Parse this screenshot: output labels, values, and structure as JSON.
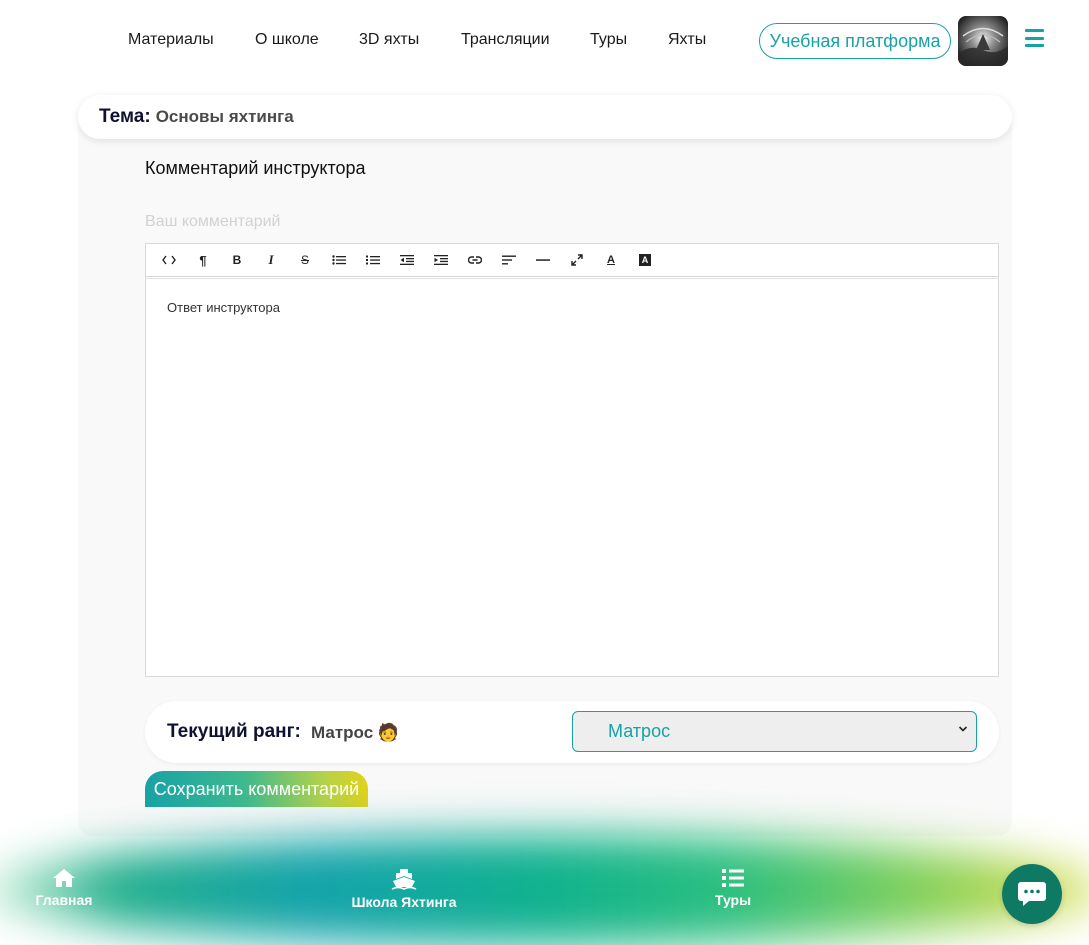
{
  "nav": {
    "links": [
      "Материалы",
      "О школе",
      "3D яхты",
      "Трансляции",
      "Туры",
      "Яхты"
    ],
    "platform_button": "Учебная платформа",
    "accent_color": "#17a2a6"
  },
  "topic": {
    "label": "Тема:",
    "value": "Основы яхтинга"
  },
  "comment_section": {
    "title": "Комментарий инструктора",
    "hint": "Ваш комментарий",
    "toolbar_icons": [
      "code-view",
      "paragraph",
      "bold",
      "italic",
      "strikethrough",
      "unordered-list",
      "ordered-list",
      "outdent",
      "indent",
      "link",
      "align",
      "horizontal-rule",
      "fullscreen",
      "font-color",
      "background-color"
    ],
    "editor_text": "Ответ инструктора"
  },
  "rank": {
    "label": "Текущий ранг:",
    "value": "Матрос 🧑",
    "selected_option": "Матрос"
  },
  "save_button": "Сохранить комментарий",
  "bottom_nav": {
    "items": [
      {
        "label": "Главная",
        "icon": "home-icon"
      },
      {
        "label": "Школа Яхтинга",
        "icon": "ship-icon"
      },
      {
        "label": "Туры",
        "icon": "list-icon"
      }
    ],
    "chat_icon": "chat-icon"
  }
}
